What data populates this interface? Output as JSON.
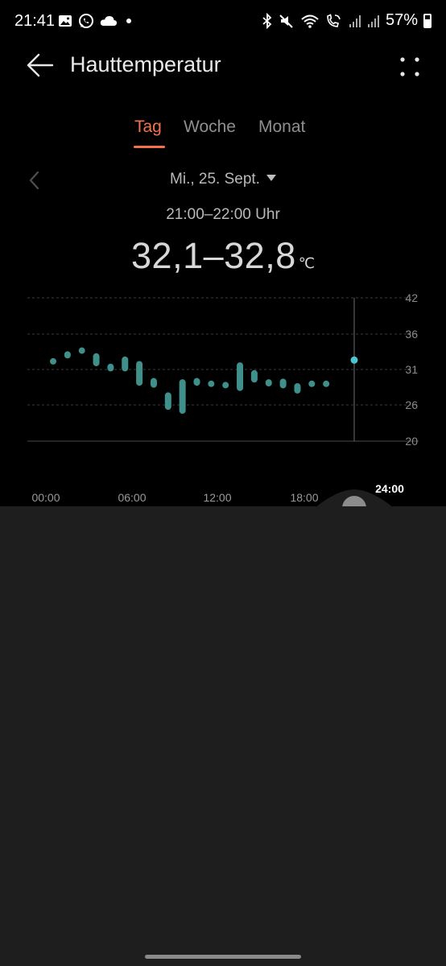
{
  "status_bar": {
    "time": "21:41",
    "left_icons": [
      "gallery-icon",
      "whatsapp-icon",
      "cloud-icon",
      "dot-icon"
    ],
    "right_icons": [
      "bluetooth-icon",
      "mute-icon",
      "wifi-icon",
      "wifi-call-icon",
      "signal-icon",
      "signal-icon"
    ],
    "battery": "57%",
    "battery_level": 0.57
  },
  "app_bar": {
    "back_icon": "arrow-left-icon",
    "title": "Hauttemperatur",
    "more_icon": "four-dots-icon"
  },
  "tabs": [
    {
      "label": "Tag",
      "active": true
    },
    {
      "label": "Woche",
      "active": false
    },
    {
      "label": "Monat",
      "active": false
    }
  ],
  "date_selector": {
    "prev_icon": "chevron-left-icon",
    "date": "Mi., 25. Sept.",
    "dropdown_icon": "caret-down-icon"
  },
  "selection": {
    "time_range": "21:00–22:00 Uhr",
    "value": "32,1–32,8",
    "unit": "℃"
  },
  "chart_data": {
    "type": "range-bar",
    "y_ticks": [
      "42",
      "36",
      "31",
      "26",
      "20"
    ],
    "ylim": [
      20,
      42
    ],
    "x_ticks": [
      "00:00",
      "06:00",
      "12:00",
      "18:00",
      "24:00"
    ],
    "x_range_hours": [
      0,
      24
    ],
    "series_color": "#3f8f8b",
    "selected_color": "#4fc4cc",
    "grid": true,
    "ranges": [
      {
        "hour": 0,
        "low": 32.0,
        "high": 32.5
      },
      {
        "hour": 1,
        "low": 32.7,
        "high": 33.8
      },
      {
        "hour": 2,
        "low": 33.6,
        "high": 34.2
      },
      {
        "hour": 3,
        "low": 31.5,
        "high": 33.5
      },
      {
        "hour": 4,
        "low": 30.7,
        "high": 31.9
      },
      {
        "hour": 5,
        "low": 30.7,
        "high": 33.0
      },
      {
        "hour": 6,
        "low": 28.5,
        "high": 32.3
      },
      {
        "hour": 7,
        "low": 28.2,
        "high": 29.7
      },
      {
        "hour": 8,
        "low": 24.8,
        "high": 27.5
      },
      {
        "hour": 9,
        "low": 24.2,
        "high": 29.5
      },
      {
        "hour": 10,
        "low": 28.5,
        "high": 29.7
      },
      {
        "hour": 11,
        "low": 28.4,
        "high": 29.2
      },
      {
        "hour": 12,
        "low": 28.2,
        "high": 29.0
      },
      {
        "hour": 13,
        "low": 27.7,
        "high": 32.1
      },
      {
        "hour": 14,
        "low": 29.0,
        "high": 30.9
      },
      {
        "hour": 15,
        "low": 28.4,
        "high": 29.5
      },
      {
        "hour": 16,
        "low": 28.1,
        "high": 29.6
      },
      {
        "hour": 17,
        "low": 27.3,
        "high": 28.9
      },
      {
        "hour": 18,
        "low": 28.4,
        "high": 29.2
      },
      {
        "hour": 19,
        "low": 28.4,
        "high": 29.2
      },
      {
        "hour": 21,
        "low": 32.1,
        "high": 32.8,
        "selected": true
      }
    ],
    "selected_hour": 21,
    "scrubber_icon": "drag-handle-icon"
  },
  "nav_bar": {
    "handle": "gesture-handle"
  }
}
